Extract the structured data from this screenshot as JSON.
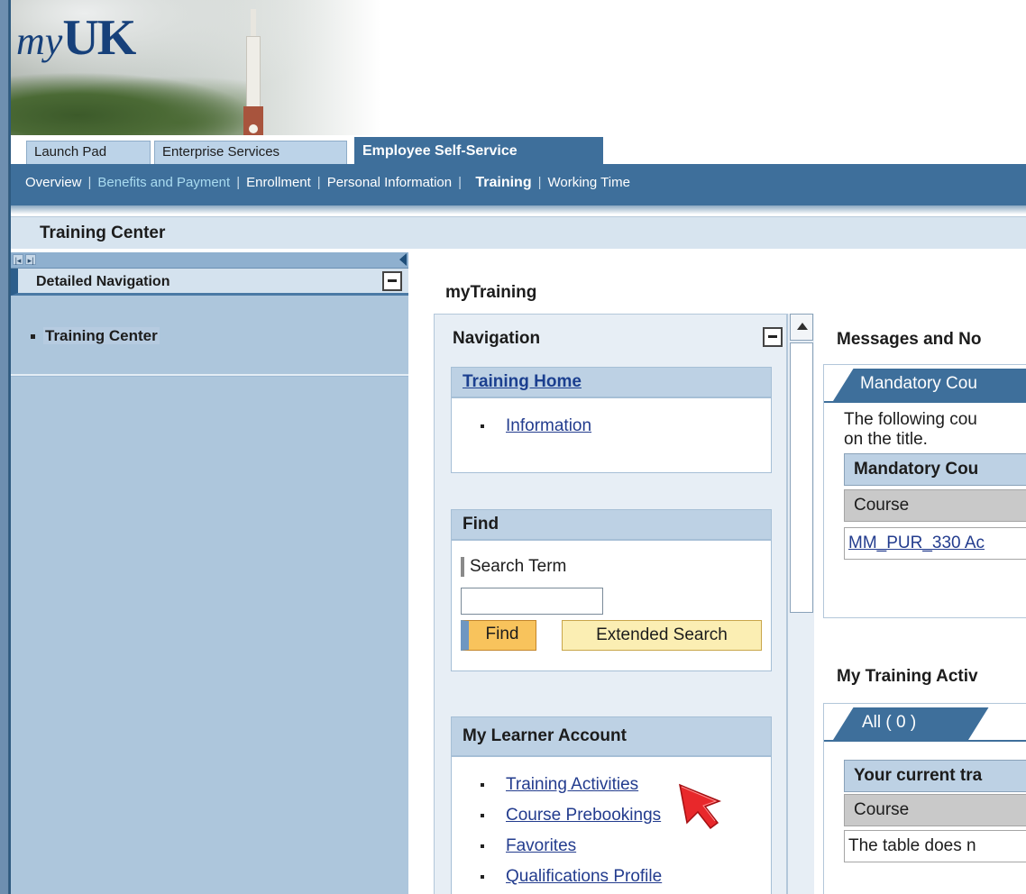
{
  "header": {
    "logo_my": "my",
    "logo_uk": "UK"
  },
  "top_tabs": [
    {
      "label": "Launch Pad",
      "active": false
    },
    {
      "label": "Enterprise Services",
      "active": false
    },
    {
      "label": "Employee Self-Service",
      "active": true
    }
  ],
  "sub_nav": [
    {
      "label": "Overview",
      "style": "normal"
    },
    {
      "label": "Benefits and Payment",
      "style": "teal"
    },
    {
      "label": "Enrollment",
      "style": "normal"
    },
    {
      "label": "Personal Information",
      "style": "normal"
    },
    {
      "label": "Training",
      "style": "bold"
    },
    {
      "label": "Working Time",
      "style": "normal"
    }
  ],
  "page_title": "Training Center",
  "left_panel": {
    "title": "Detailed Navigation",
    "items": [
      {
        "label": "Training Center",
        "selected": true
      }
    ]
  },
  "main": {
    "title": "myTraining",
    "navigation": {
      "title": "Navigation",
      "training_home": {
        "title": "Training Home",
        "links": [
          "Information"
        ]
      },
      "find": {
        "title": "Find",
        "search_label": "Search Term",
        "search_value": "",
        "find_button": "Find",
        "extended_button": "Extended Search"
      },
      "learner_account": {
        "title": "My Learner Account",
        "links": [
          "Training Activities",
          "Course Prebookings",
          "Favorites",
          "Qualifications Profile"
        ]
      }
    },
    "messages": {
      "title": "Messages and No",
      "tab_label": "Mandatory Cou",
      "paragraph_line1": "The following cou",
      "paragraph_line2": "on the title.",
      "table_title": "Mandatory Cou",
      "column_header": "Course",
      "row_value": "MM_PUR_330 Ac"
    },
    "activities": {
      "title": "My Training Activ",
      "tab_label": "All  ( 0 )",
      "table_title": "Your current tra",
      "column_header": "Course",
      "empty_text": "The table does n"
    }
  },
  "colors": {
    "brand_blue": "#3e6f9b",
    "link_blue": "#233c8e",
    "find_button": "#f8c35c",
    "extended_button": "#fbeeb3",
    "cursor": "#e8282b"
  }
}
